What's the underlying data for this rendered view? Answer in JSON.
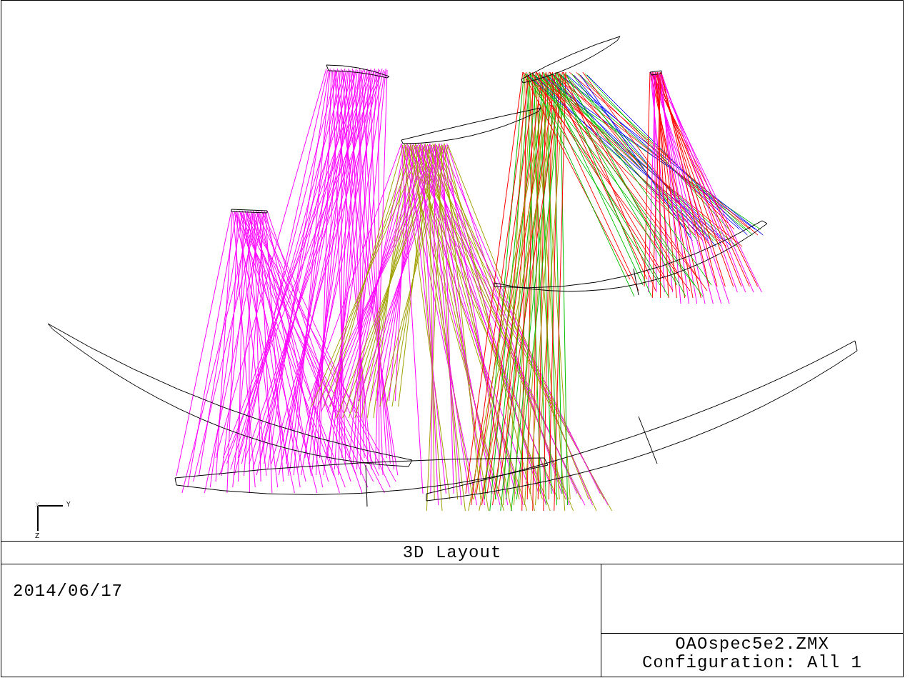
{
  "plot": {
    "axes": [
      {
        "label": "X",
        "faded": true
      },
      {
        "label": "Y",
        "faded": false
      },
      {
        "label": "Z",
        "faded": false
      }
    ]
  },
  "title": "3D Layout",
  "date": "2014/06/17",
  "file_name": "OAOspec5e2.ZMX",
  "configuration": "Configuration: All 1"
}
